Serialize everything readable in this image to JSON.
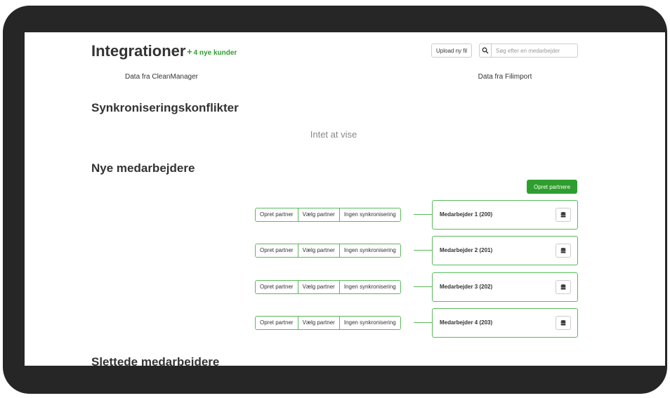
{
  "header": {
    "title": "Integrationer",
    "new_customers": "4 nye kunder",
    "upload_label": "Upload ny fil",
    "search_placeholder": "Søg efter en medarbejder"
  },
  "columns": {
    "left": "Data fra CleanManager",
    "right": "Data fra Filimport"
  },
  "conflicts": {
    "heading": "Synkroniseringskonflikter",
    "empty_text": "Intet at vise"
  },
  "new_employees": {
    "heading": "Nye medarbejdere",
    "create_all_label": "Opret partnere",
    "actions": [
      "Opret partner",
      "Vælg partner",
      "Ingen synkronisering"
    ],
    "rows": [
      {
        "name": "Medarbejder 1 (200)"
      },
      {
        "name": "Medarbejder 2 (201)"
      },
      {
        "name": "Medarbejder 3 (202)"
      },
      {
        "name": "Medarbejder 4 (203)"
      }
    ]
  },
  "deleted_employees": {
    "heading": "Slettede medarbejdere"
  },
  "colors": {
    "accent_green": "#2e9e2e",
    "border_green": "#5cb85c",
    "bezel": "#262626"
  }
}
